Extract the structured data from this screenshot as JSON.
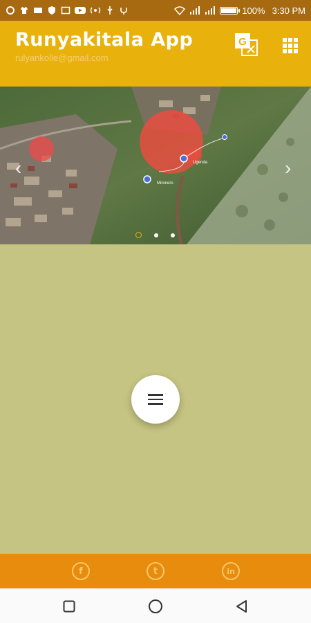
{
  "status_bar": {
    "battery_percent": "100%",
    "battery_level": 1.0,
    "time": "3:30 PM"
  },
  "app_bar": {
    "title": "Runyakitala App",
    "email": "rulyankolle@gmail.com",
    "icons": [
      "translate-icon",
      "apps-grid-icon"
    ]
  },
  "slider": {
    "map_labels": [
      "Ugenda",
      "Mironero"
    ],
    "page_count": 3,
    "active_page": 1
  },
  "footer": {
    "social": [
      {
        "name": "facebook",
        "glyph": "f"
      },
      {
        "name": "twitter",
        "glyph": "t"
      },
      {
        "name": "linkedin",
        "glyph": "in"
      }
    ]
  },
  "colors": {
    "status_bar": "#a86a10",
    "app_bar": "#e9b10c",
    "content_bg": "#c6c482",
    "footer": "#e88c0d"
  }
}
